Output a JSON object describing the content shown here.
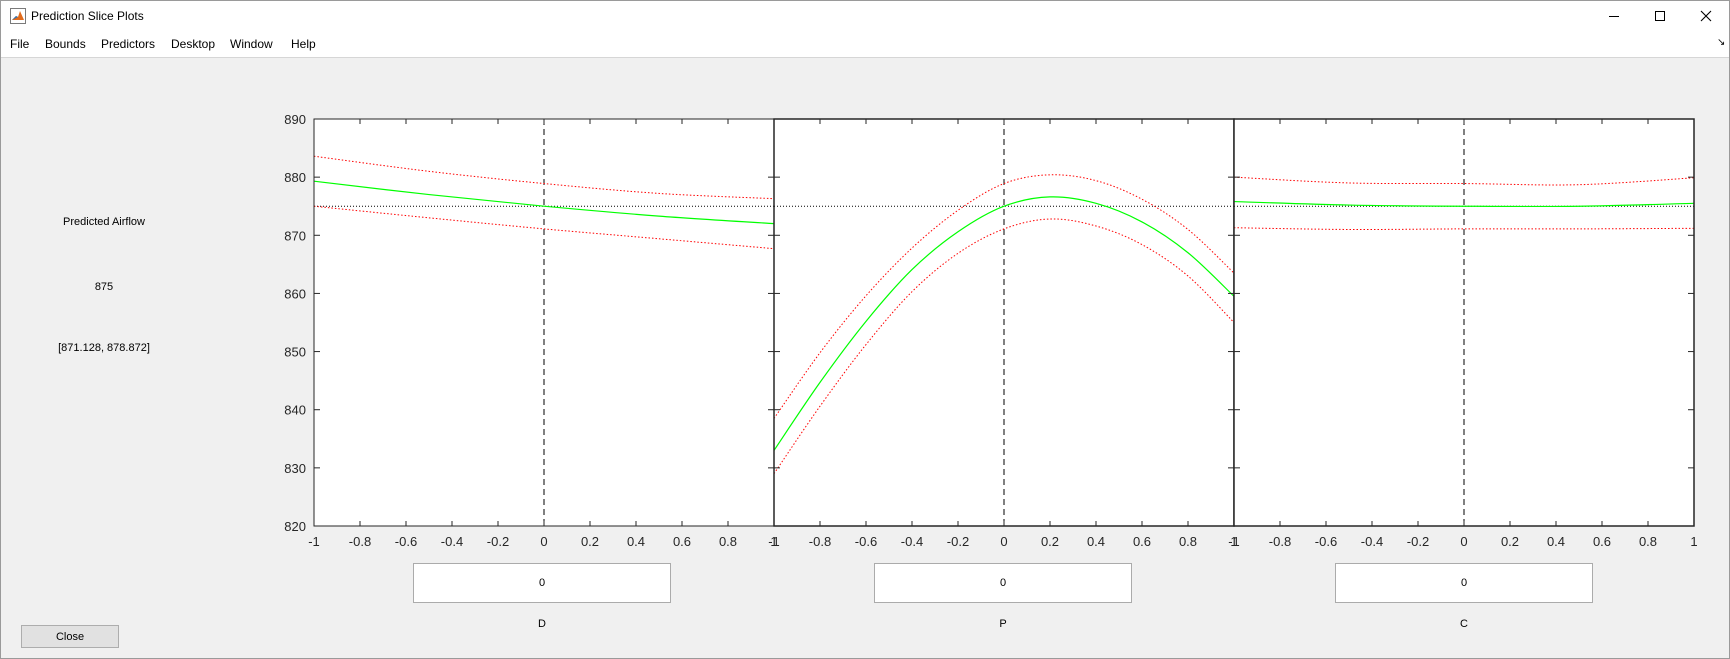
{
  "window": {
    "title": "Prediction Slice Plots"
  },
  "menu": {
    "items": [
      "File",
      "Bounds",
      "Predictors",
      "Desktop",
      "Window",
      "Help"
    ]
  },
  "prediction": {
    "label": "Predicted Airflow",
    "value": "875",
    "interval": "[871.128, 878.872]"
  },
  "factors": [
    {
      "name": "D",
      "value": "0"
    },
    {
      "name": "P",
      "value": "0"
    },
    {
      "name": "C",
      "value": "0"
    }
  ],
  "close_label": "Close",
  "icons": {
    "app": "matlab-icon",
    "minimize": "minimize-icon",
    "maximize": "maximize-icon",
    "close": "close-icon",
    "dock": "dock-arrow-icon"
  },
  "colors": {
    "prediction": "#00ff00",
    "confidence": "#ff0000",
    "reference": "#000000"
  },
  "chart_data": {
    "type": "line",
    "y_ticks": [
      "820",
      "830",
      "840",
      "850",
      "860",
      "870",
      "880",
      "890"
    ],
    "x_ticks": [
      "-1",
      "-0.8",
      "-0.6",
      "-0.4",
      "-0.2",
      "0",
      "0.2",
      "0.4",
      "0.6",
      "0.8",
      "1"
    ],
    "ylim": [
      820,
      890
    ],
    "xlim": [
      -1,
      1
    ],
    "grid": false,
    "reference_y": 875,
    "panels": [
      {
        "factor": "D",
        "current_x": 0,
        "x": [
          -1,
          -0.5,
          0,
          0.5,
          1
        ],
        "prediction": [
          879.3,
          877.0,
          875.0,
          873.3,
          872.0
        ],
        "upper": [
          883.6,
          881.0,
          878.9,
          877.2,
          876.3
        ],
        "lower": [
          875.0,
          873.0,
          871.1,
          869.4,
          867.7
        ]
      },
      {
        "factor": "P",
        "current_x": 0,
        "x": [
          -1,
          -0.8,
          -0.6,
          -0.4,
          -0.2,
          0,
          0.2,
          0.4,
          0.6,
          0.8,
          1
        ],
        "prediction": [
          833.0,
          844.7,
          855.2,
          864.1,
          870.6,
          875.0,
          876.6,
          875.5,
          872.3,
          867.0,
          859.5
        ],
        "upper": [
          838.5,
          849.8,
          859.6,
          867.8,
          874.3,
          878.9,
          880.4,
          879.4,
          876.2,
          871.0,
          863.5
        ],
        "lower": [
          829.0,
          840.6,
          851.2,
          860.3,
          866.9,
          871.1,
          872.8,
          871.6,
          868.4,
          863.0,
          855.0
        ]
      },
      {
        "factor": "C",
        "current_x": 0,
        "x": [
          -1,
          -0.5,
          0,
          0.5,
          1
        ],
        "prediction": [
          875.8,
          875.2,
          875.0,
          875.0,
          875.5
        ],
        "upper": [
          880.0,
          879.0,
          878.9,
          878.7,
          879.9
        ],
        "lower": [
          871.3,
          871.0,
          871.1,
          871.1,
          871.2
        ]
      }
    ]
  }
}
